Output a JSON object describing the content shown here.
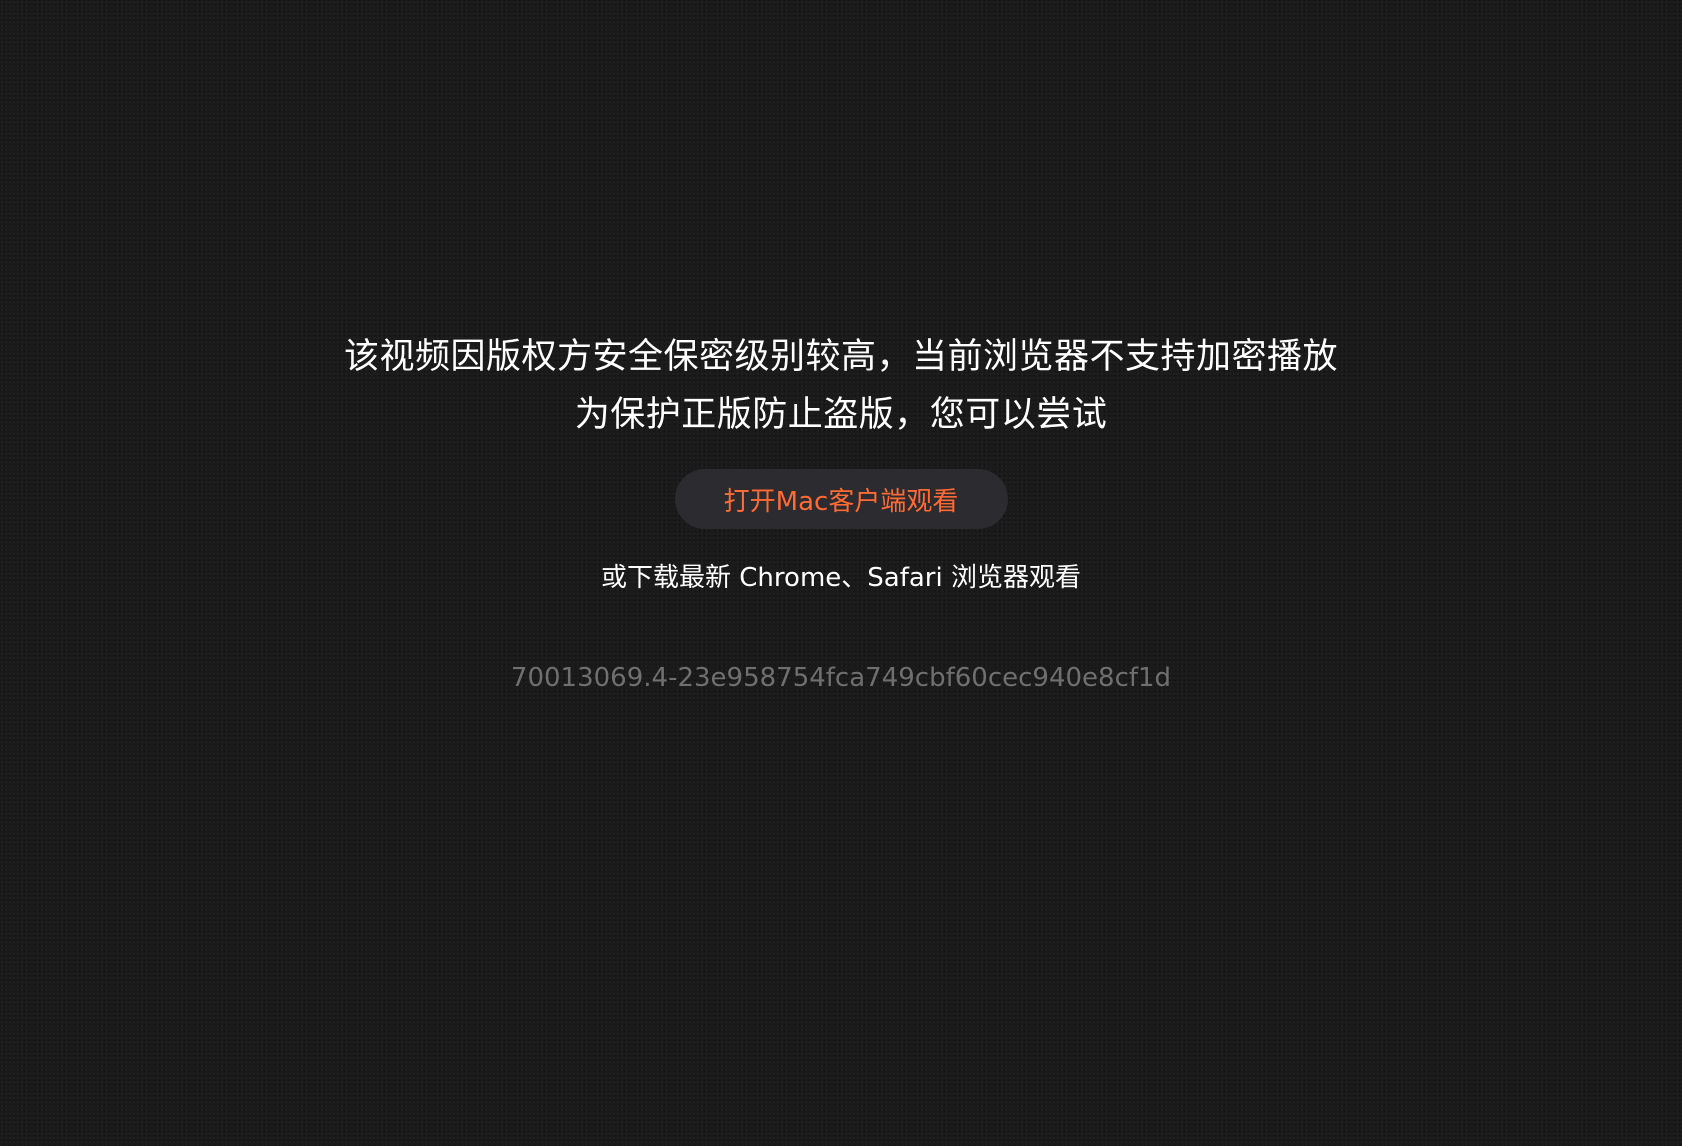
{
  "notice": {
    "line1": "该视频因版权方安全保密级别较高，当前浏览器不支持加密播放",
    "line2": "为保护正版防止盗版，您可以尝试",
    "open_client_button": "打开Mac客户端观看",
    "alt_browsers": "或下载最新 Chrome、Safari 浏览器观看",
    "error_code": "70013069.4-23e958754fca749cbf60cec940e8cf1d"
  },
  "colors": {
    "background": "#1a1a1a",
    "text": "#ffffff",
    "accent": "#ff6a33",
    "button_bg": "#2b2b30",
    "muted": "#6f6f6f"
  }
}
